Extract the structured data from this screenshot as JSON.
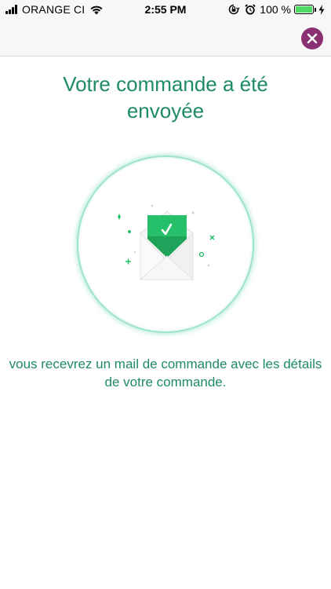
{
  "status_bar": {
    "carrier": "ORANGE CI",
    "time": "2:55 PM",
    "battery_percent": "100 %",
    "battery_level": 1.0,
    "icons": [
      "signal-icon",
      "wifi-icon",
      "orientation-lock-icon",
      "alarm-icon",
      "battery-icon",
      "charging-icon"
    ]
  },
  "header": {
    "close_icon": "close-icon",
    "close_color": "#8a2f72"
  },
  "confirmation": {
    "title": "Votre commande a été envoyée",
    "message": "vous recevrez un mail de commande avec les détails de votre commande.",
    "illustration_icon": "envelope-check-icon",
    "accent_color": "#1f8a6a",
    "check_color": "#27c06a"
  }
}
